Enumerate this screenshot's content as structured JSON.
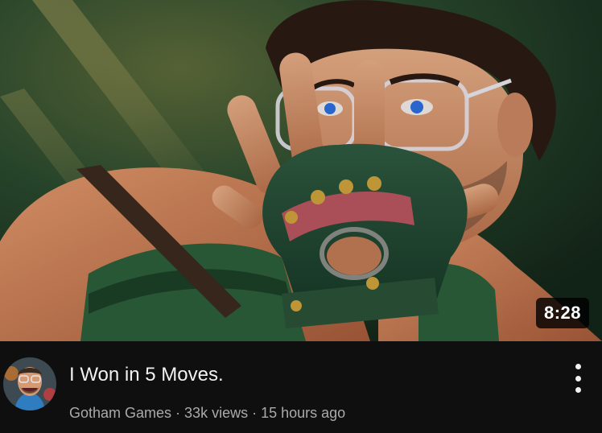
{
  "video": {
    "duration": "8:28",
    "title": "I Won in 5 Moves.",
    "channel": "Gotham Games",
    "views": "33k views",
    "age": "15 hours ago",
    "separator": " · "
  },
  "icons": {
    "more": "more-vert-icon",
    "avatar": "channel-avatar"
  },
  "colors": {
    "background": "#0f0f0f",
    "title": "#f1f1f1",
    "subtext": "#aaaaaa",
    "duration_bg": "#000000"
  }
}
